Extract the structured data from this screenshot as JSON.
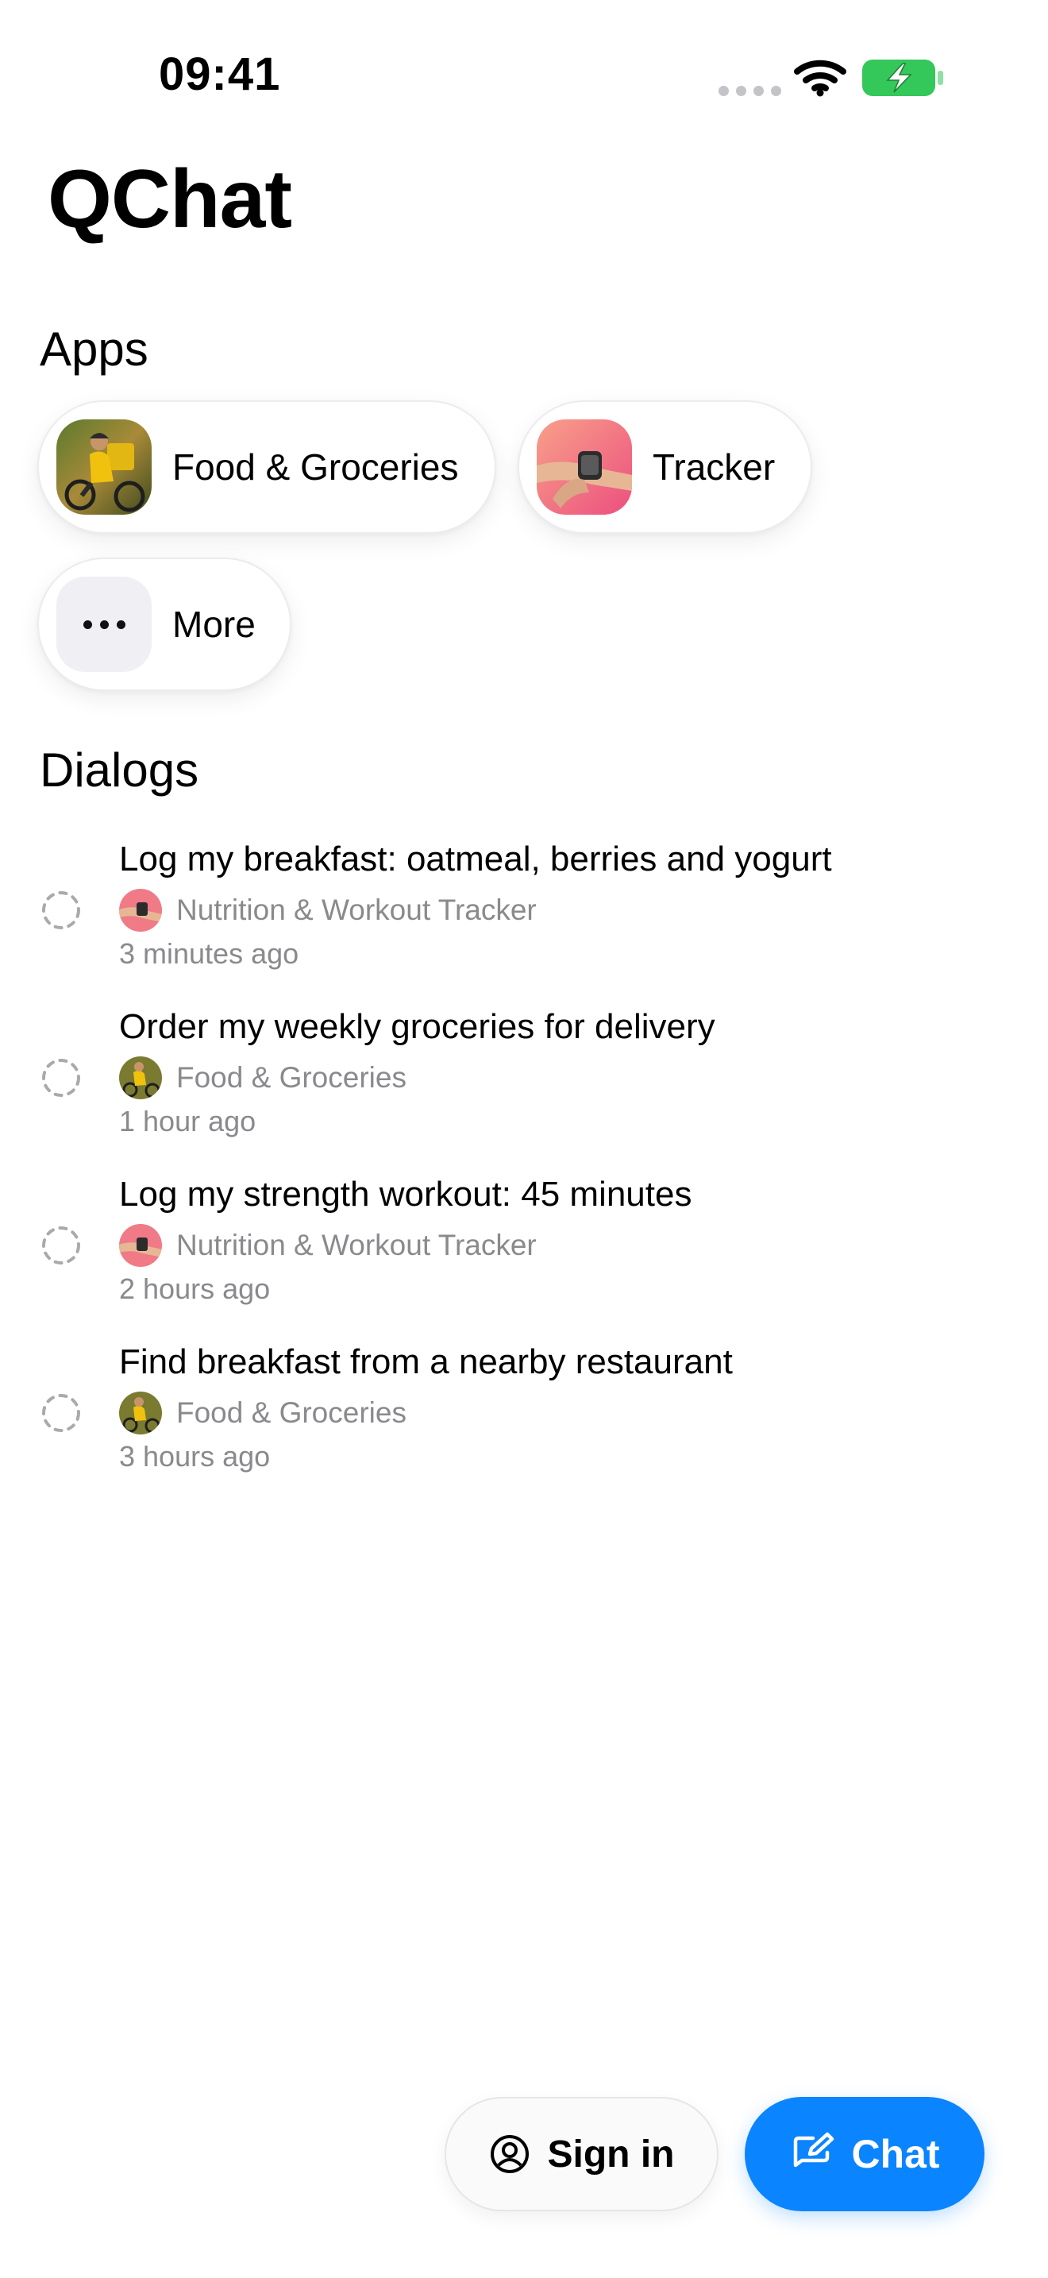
{
  "status_bar": {
    "time": "09:41",
    "battery_color": "#34c759"
  },
  "header": {
    "title": "QChat"
  },
  "apps": {
    "title": "Apps",
    "items": [
      {
        "label": "Food & Groceries",
        "icon": "food-groceries-app-icon"
      },
      {
        "label": "Tracker",
        "icon": "tracker-app-icon"
      },
      {
        "label": "More",
        "icon": "more-dots-icon"
      }
    ]
  },
  "dialogs": {
    "title": "Dialogs",
    "items": [
      {
        "title": "Log my breakfast: oatmeal, berries and yogurt",
        "app": "Nutrition & Workout Tracker",
        "time": "3 minutes ago"
      },
      {
        "title": "Order my weekly groceries for delivery",
        "app": "Food & Groceries",
        "time": "1 hour ago"
      },
      {
        "title": "Log my strength workout: 45 minutes",
        "app": "Nutrition & Workout Tracker",
        "time": "2 hours ago"
      },
      {
        "title": "Find breakfast from a nearby restaurant",
        "app": "Food & Groceries",
        "time": "3 hours ago"
      }
    ]
  },
  "footer": {
    "sign_in_label": "Sign in",
    "chat_label": "Chat",
    "accent_color": "#0a84ff"
  }
}
